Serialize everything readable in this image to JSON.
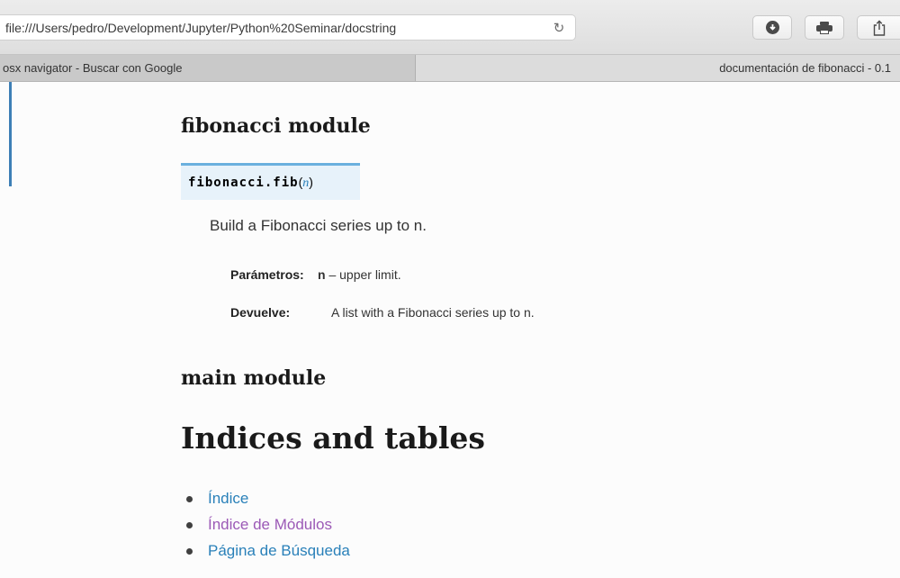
{
  "browser": {
    "url": "file:///Users/pedro/Development/Jupyter/Python%20Seminar/docstring",
    "tabs": [
      {
        "title": "osx navigator - Buscar con Google",
        "active": false
      },
      {
        "title": "documentación de fibonacci - 0.1",
        "active": true
      }
    ],
    "icons": [
      "reload-icon",
      "download-icon",
      "print-icon",
      "share-icon"
    ]
  },
  "doc": {
    "fib_module_title": "fibonacci module",
    "signature": {
      "name": "fibonacci.fib",
      "open_paren": "(",
      "param": "n",
      "close_paren": ")"
    },
    "description": "Build a Fibonacci series up to n.",
    "params_label": "Parámetros:",
    "param_name": "n",
    "param_desc": " – upper limit.",
    "returns_label": "Devuelve:",
    "returns_desc": "A list with a Fibonacci series up to n.",
    "main_module_title": "main module",
    "indices_title": "Indices and tables",
    "links": [
      "Índice",
      "Índice de Módulos",
      "Página de Búsqueda"
    ]
  },
  "colors": {
    "link": "#2980b9",
    "visited_link": "#9b59b6",
    "signature_bg": "#e7f2fa",
    "signature_border": "#6ab0de"
  }
}
